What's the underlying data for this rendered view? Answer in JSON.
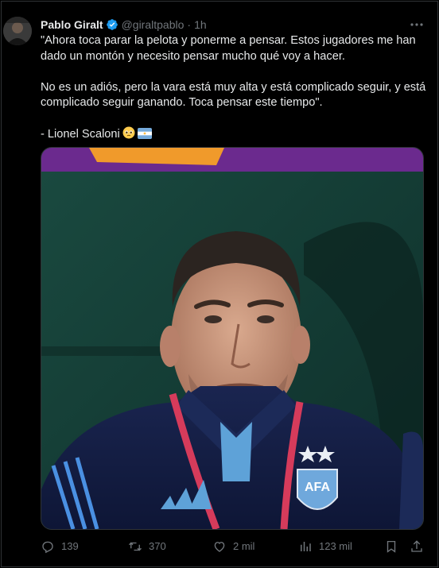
{
  "tweet": {
    "author_name": "Pablo Giralt",
    "handle": "@giraltpablo",
    "separator": "·",
    "time": "1h",
    "paragraphs": [
      "\"Ahora toca parar la pelota y ponerme a pensar. Estos jugadores me han dado un montón y necesito pensar mucho qué voy a hacer.",
      "No es un adiós, pero la vara está muy alta y está complicado seguir, y está complicado seguir ganando. Toca pensar este tiempo\".",
      "- Lionel Scaloni"
    ],
    "signature_emojis": [
      "pleading-face-emoji",
      "argentina-flag-emoji"
    ]
  },
  "media": {
    "description_icon": "photo",
    "shirt_text": "AFA"
  },
  "actions": {
    "replies": "139",
    "retweets": "370",
    "likes": "2 mil",
    "views": "123 mil"
  },
  "colors": {
    "background": "#000000",
    "text": "#e7e9ea",
    "muted": "#71767b",
    "verified": "#1d9bf0",
    "border": "#2f3336"
  }
}
